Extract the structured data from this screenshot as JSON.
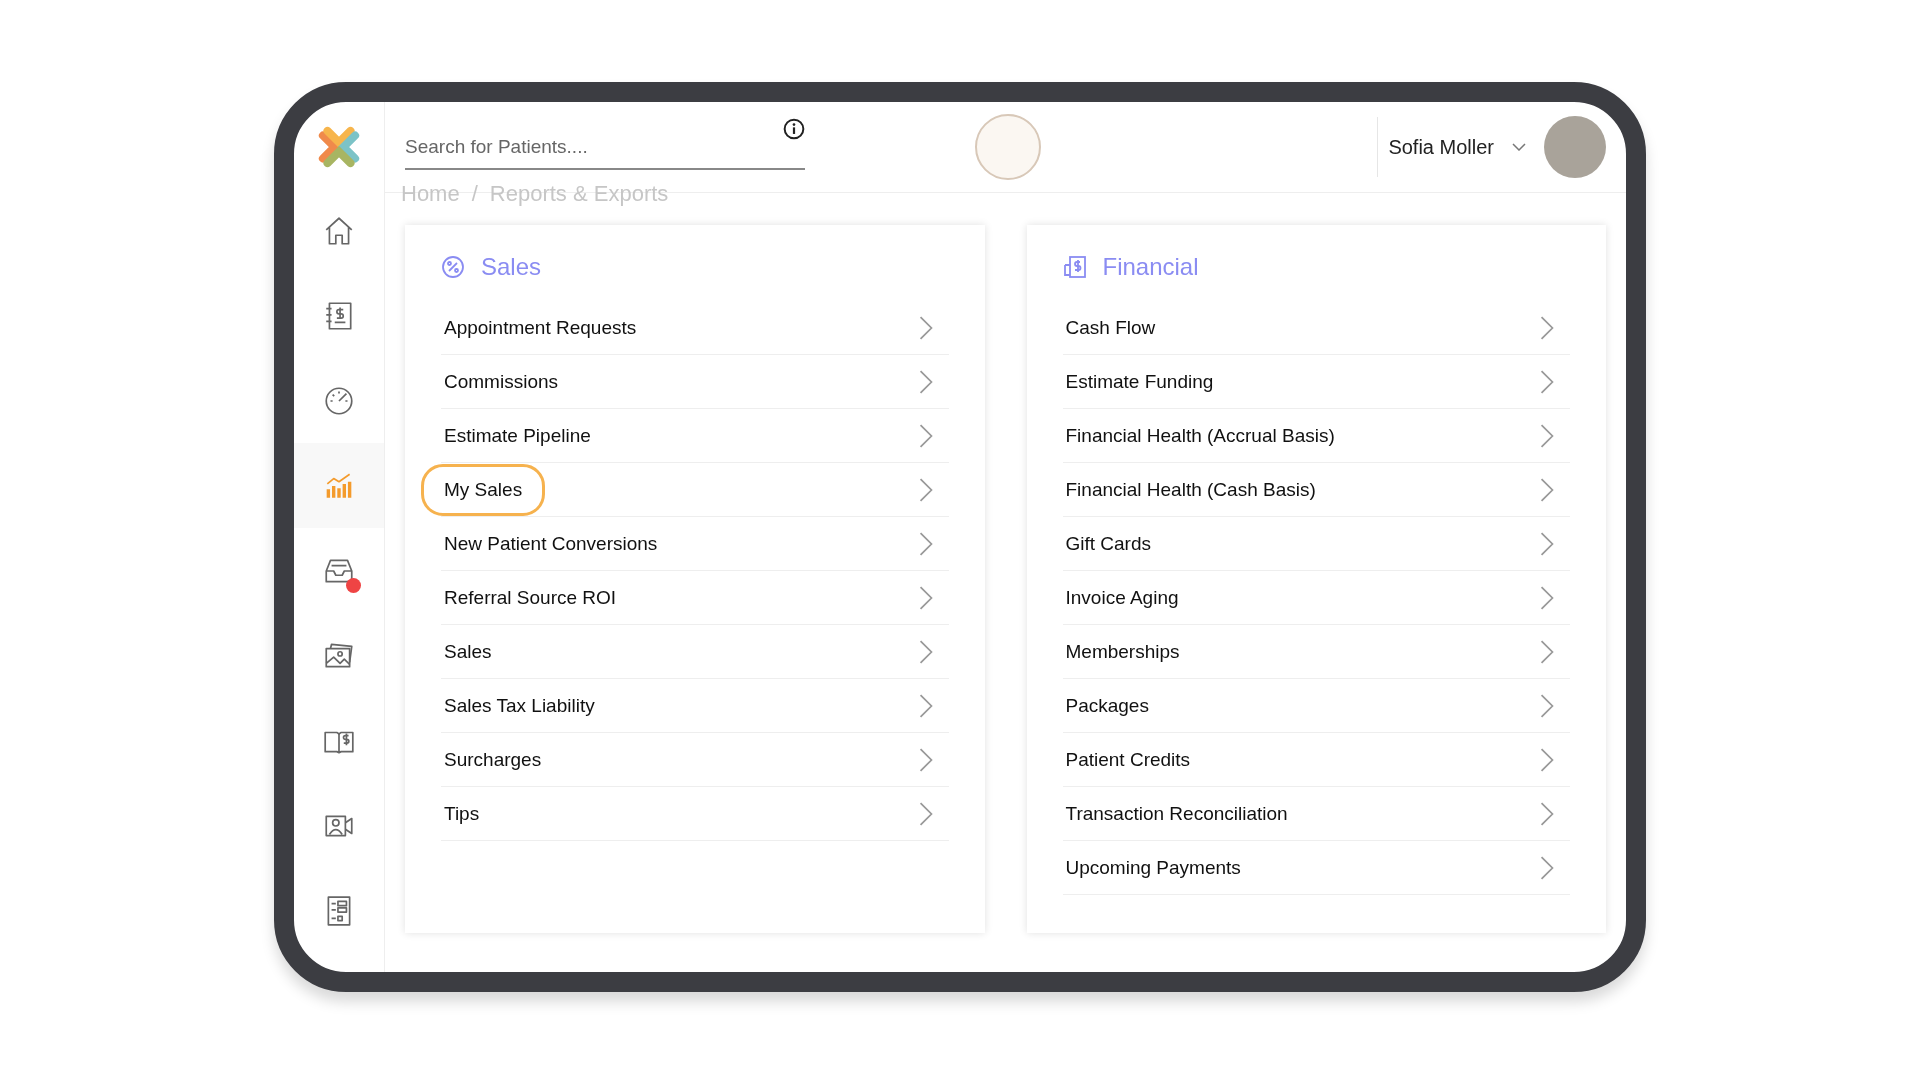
{
  "sidebar": {
    "items": [
      {
        "selected": false,
        "notification": false
      },
      {
        "selected": false,
        "notification": false
      },
      {
        "selected": false,
        "notification": false
      },
      {
        "selected": true,
        "notification": false
      },
      {
        "selected": false,
        "notification": true
      },
      {
        "selected": false,
        "notification": false
      },
      {
        "selected": false,
        "notification": false
      },
      {
        "selected": false,
        "notification": false
      },
      {
        "selected": false,
        "notification": false
      }
    ]
  },
  "header": {
    "search": {
      "placeholder": "Search for Patients...."
    },
    "user": {
      "name": "Sofia Moller"
    }
  },
  "breadcrumb": {
    "items": [
      "Home",
      "Reports & Exports"
    ],
    "separator": "/"
  },
  "panels": [
    {
      "title": "Sales",
      "items": [
        {
          "label": "Appointment Requests",
          "highlighted": false
        },
        {
          "label": "Commissions",
          "highlighted": false
        },
        {
          "label": "Estimate Pipeline",
          "highlighted": false
        },
        {
          "label": "My Sales",
          "highlighted": true
        },
        {
          "label": "New Patient Conversions",
          "highlighted": false
        },
        {
          "label": "Referral Source ROI",
          "highlighted": false
        },
        {
          "label": "Sales",
          "highlighted": false
        },
        {
          "label": "Sales Tax Liability",
          "highlighted": false
        },
        {
          "label": "Surcharges",
          "highlighted": false
        },
        {
          "label": "Tips",
          "highlighted": false
        }
      ]
    },
    {
      "title": "Financial",
      "items": [
        {
          "label": "Cash Flow",
          "highlighted": false
        },
        {
          "label": "Estimate Funding",
          "highlighted": false
        },
        {
          "label": "Financial Health (Accrual Basis)",
          "highlighted": false
        },
        {
          "label": "Financial Health (Cash Basis)",
          "highlighted": false
        },
        {
          "label": "Gift Cards",
          "highlighted": false
        },
        {
          "label": "Invoice Aging",
          "highlighted": false
        },
        {
          "label": "Memberships",
          "highlighted": false
        },
        {
          "label": "Packages",
          "highlighted": false
        },
        {
          "label": "Patient Credits",
          "highlighted": false
        },
        {
          "label": "Transaction Reconciliation",
          "highlighted": false
        },
        {
          "label": "Upcoming Payments",
          "highlighted": false
        }
      ]
    }
  ]
}
